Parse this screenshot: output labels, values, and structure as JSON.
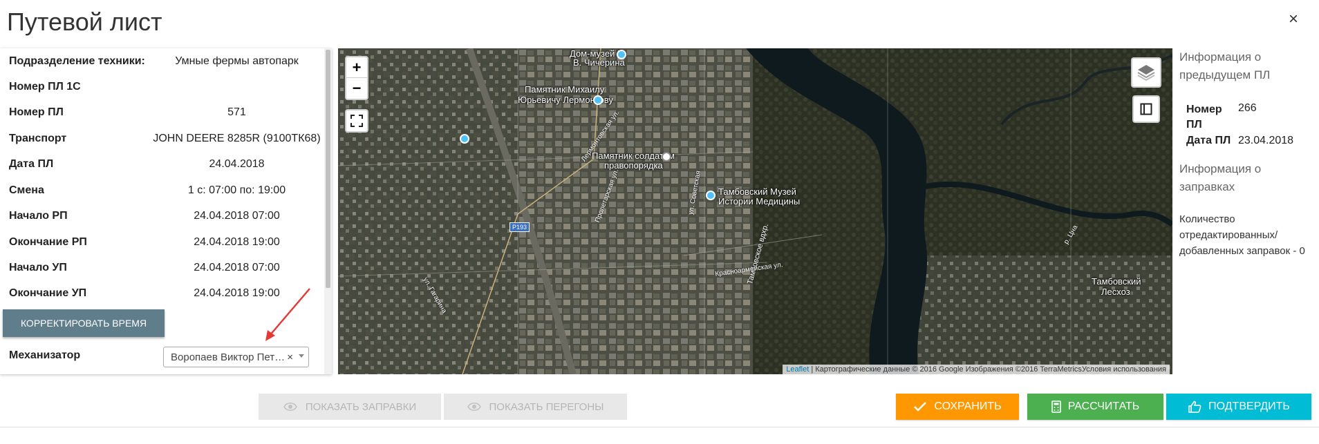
{
  "modal": {
    "title": "Путевой лист",
    "close": "×"
  },
  "details": [
    {
      "label": "Подразделение техники:",
      "value": "Умные фермы автопарк"
    },
    {
      "label": "Номер ПЛ 1С",
      "value": ""
    },
    {
      "label": "Номер ПЛ",
      "value": "571"
    },
    {
      "label": "Транспорт",
      "value": "JOHN DEERE 8285R (9100ТК68)"
    },
    {
      "label": "Дата ПЛ",
      "value": "24.04.2018"
    },
    {
      "label": "Смена",
      "value": "1 с: 07:00 по: 19:00"
    },
    {
      "label": "Начало РП",
      "value": "24.04.2018 07:00"
    },
    {
      "label": "Окончание РП",
      "value": "24.04.2018 19:00"
    },
    {
      "label": "Начало УП",
      "value": "24.04.2018 07:00"
    },
    {
      "label": "Окончание УП",
      "value": "24.04.2018 19:00"
    }
  ],
  "correct_time_button": "КОРРЕКТИРОВАТЬ ВРЕМЯ",
  "mechanic": {
    "label": "Механизатор",
    "selected": "Воропаев Виктор Петрович",
    "clear": "×"
  },
  "map": {
    "zoom_in": "+",
    "zoom_out": "−",
    "labels": {
      "museum_house": "Дом-музей Г.",
      "museum_house2": "В. Чичерина",
      "lermontov1": "Памятник Михаилу",
      "lermontov2": "Юрьевичу Лермонтову",
      "soldiers1": "Памятник солдатам",
      "soldiers2": "правопорядка",
      "med1": "Тамбовский Музей",
      "med2": "Истории Медицины",
      "forest1": "Тамбовский",
      "forest2": "Лесхоз",
      "reservoir": "Тамбовское вдхр.",
      "route": "Р193",
      "krasnoarm": "Красноармейская ул.",
      "gagarina": "ул. Гагарина",
      "sovetskaya": "ул. Советская",
      "proletarskaya": "Пролетарская ул.",
      "lermontovskaya": "Лермонтовская ул.",
      "tsna": "р. Цна"
    },
    "attribution_link": "Leaflet",
    "attribution_text": "| Картографические данные © 2016 Google Изображения ©2016 TerraMetricsУсловия использования"
  },
  "right_info": {
    "prev_heading": "Информация о предыдущем ПЛ",
    "num_key": "Номер ПЛ",
    "num_val": "266",
    "date_key": "Дата ПЛ",
    "date_val": "23.04.2018",
    "fuel_heading": "Информация о заправках",
    "edited_text": "Количество отредактированных/ добавленных заправок - 0"
  },
  "buttons": {
    "show_fuel": "ПОКАЗАТЬ ЗАПРАВКИ",
    "show_routes": "ПОКАЗАТЬ ПЕРЕГОНЫ",
    "save": "СОХРАНИТЬ",
    "calculate": "РАССЧИТАТЬ",
    "confirm": "ПОДТВЕРДИТЬ"
  },
  "colors": {
    "save": "#ff9800",
    "calculate": "#4caf50",
    "confirm": "#00bcd4",
    "correct": "#607d8b"
  }
}
